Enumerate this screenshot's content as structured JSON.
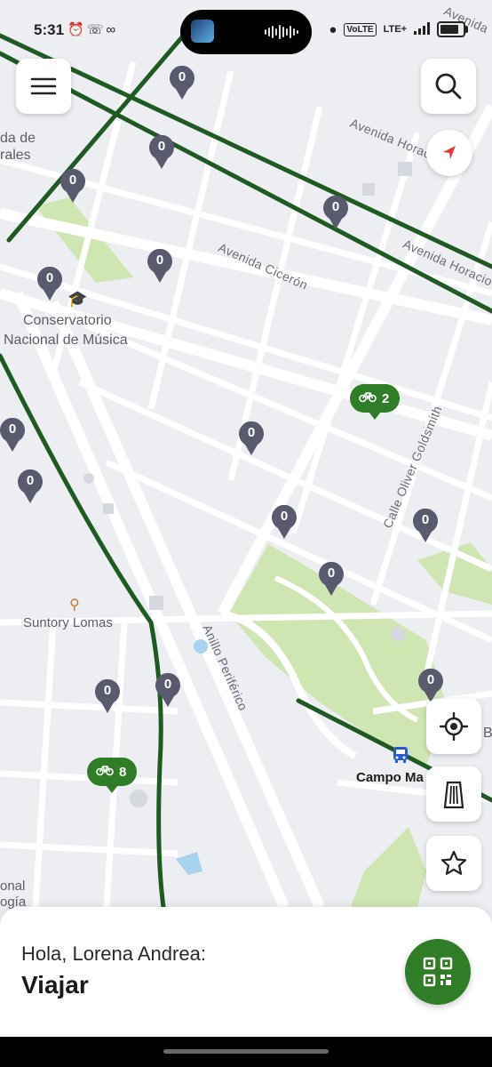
{
  "status_bar": {
    "time": "5:31",
    "left_icons": [
      "alarm-icon",
      "whatsapp-icon",
      "bike-icon"
    ],
    "network": "VoLTE",
    "lte": "LTE+",
    "sim_slot": "2"
  },
  "map": {
    "street_labels": {
      "avenida_cicero": "Avenida Cicerón",
      "avenida_horacio_top": "Avenida Horacio",
      "avenida_horacio_right": "Avenida Horacio",
      "calle_oliver": "Calle Oliver Goldsmith",
      "anillo": "Anillo Periférico",
      "avenida_corner": "Avenida"
    },
    "poi_labels": {
      "conservatorio_1": "Conservatorio",
      "conservatorio_2": "Nacional de Música",
      "suntory": "Suntory Lomas",
      "campo": "Campo Ma",
      "left_edge_1": "da de",
      "left_edge_2": "rales",
      "bottom_left_1": "onal",
      "bottom_left_2": "ogía",
      "right_edge": "B"
    },
    "markers": [
      "0",
      "0",
      "0",
      "0",
      "0",
      "0",
      "0",
      "0",
      "0",
      "0",
      "0",
      "0",
      "0",
      "0",
      "0",
      "0",
      "0"
    ],
    "stations": [
      {
        "count": "2"
      },
      {
        "count": "8"
      }
    ],
    "colors": {
      "route_green": "#1f5a23",
      "park": "#cfe6b2",
      "marker": "#5a5a6e",
      "station": "#2f7d27"
    }
  },
  "controls": {
    "menu_icon": "menu-icon",
    "search_icon": "search-icon",
    "compass_icon": "compass-icon",
    "locate_icon": "crosshair-icon",
    "building_icon": "building-icon",
    "favorite_icon": "star-icon"
  },
  "bottom_sheet": {
    "greeting": "Hola, Lorena Andrea:",
    "title": "Viajar",
    "qr_icon": "qr-code-icon"
  }
}
